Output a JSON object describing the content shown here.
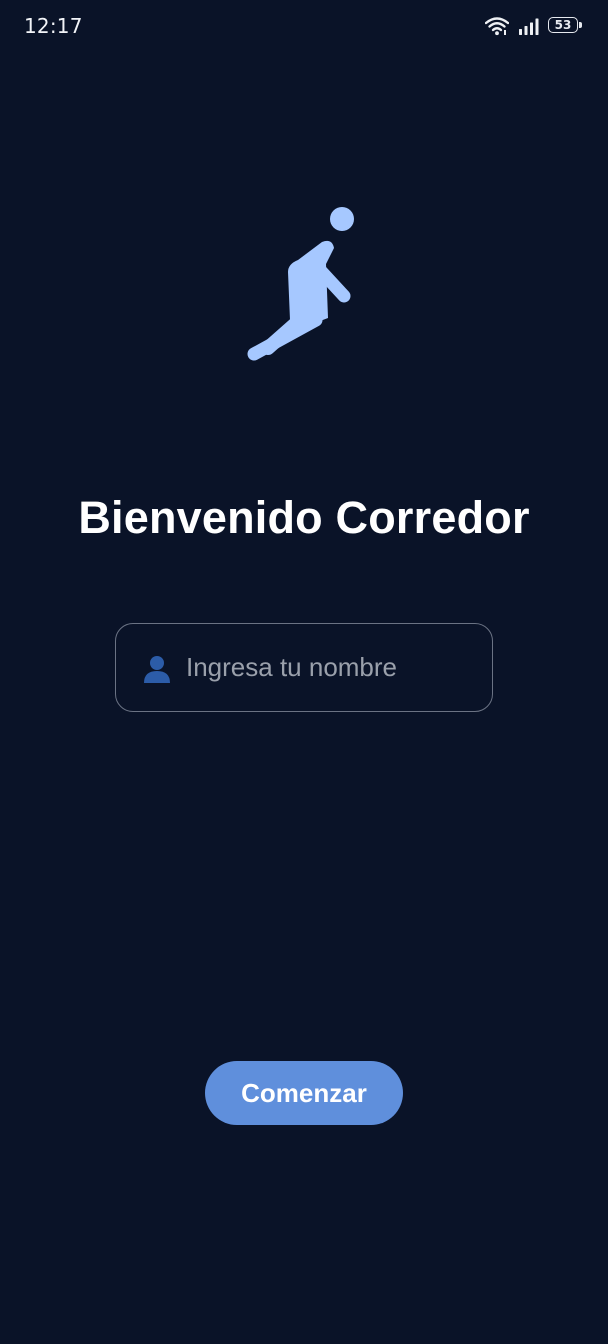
{
  "status_bar": {
    "time": "12:17",
    "battery_level": "53",
    "icons": [
      "wifi-icon",
      "signal-icon",
      "battery-icon"
    ]
  },
  "logo": {
    "icon": "runner-icon",
    "color": "#a6c8ff"
  },
  "welcome": {
    "title": "Bienvenido Corredor"
  },
  "name_input": {
    "icon": "user-icon",
    "placeholder": "Ingresa tu nombre",
    "value": ""
  },
  "actions": {
    "start_label": "Comenzar"
  },
  "colors": {
    "background": "#0a1328",
    "accent": "#5f8fdc",
    "logo": "#a6c8ff",
    "input_border": "#6b7384"
  }
}
